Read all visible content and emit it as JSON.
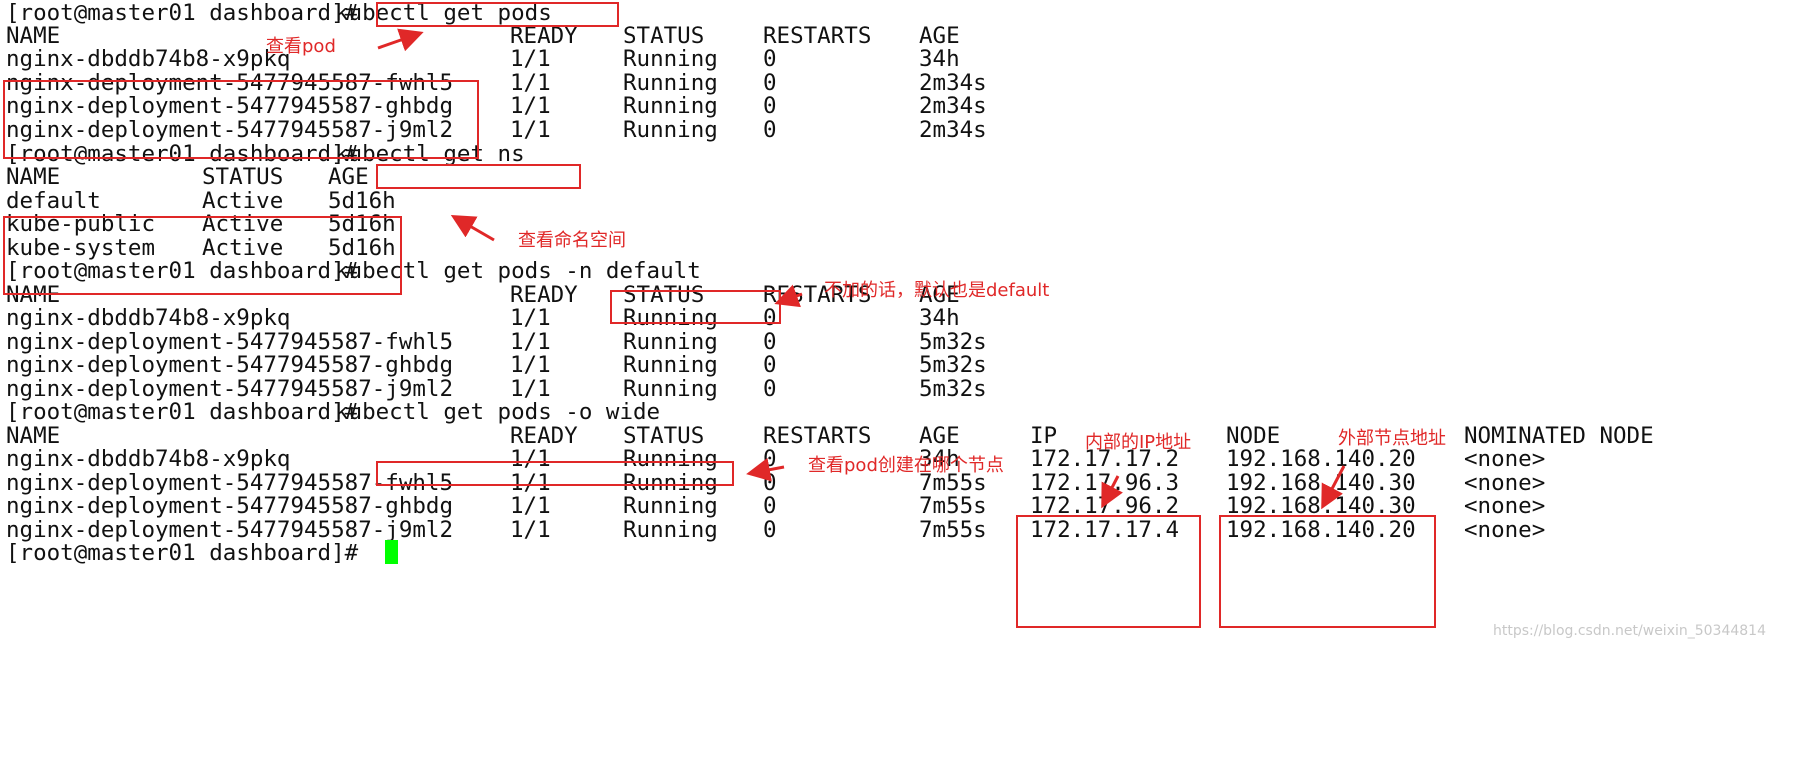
{
  "colors": {
    "annotation": "#e02828",
    "cursor": "#00ff00",
    "text": "#111111",
    "watermark": "#c8c8c8"
  },
  "terminal": {
    "blocks": [
      {
        "prompt": "[root@master01 dashboard]# ",
        "command": "kubectl get pods",
        "cols": [
          "NAME",
          "READY",
          "STATUS",
          "RESTARTS",
          "AGE"
        ],
        "rows": [
          [
            "nginx-dbddb74b8-x9pkq",
            "1/1",
            "Running",
            "0",
            "34h"
          ],
          [
            "nginx-deployment-5477945587-fwhl5",
            "1/1",
            "Running",
            "0",
            "2m34s"
          ],
          [
            "nginx-deployment-5477945587-ghbdg",
            "1/1",
            "Running",
            "0",
            "2m34s"
          ],
          [
            "nginx-deployment-5477945587-j9ml2",
            "1/1",
            "Running",
            "0",
            "2m34s"
          ]
        ]
      },
      {
        "prompt": "[root@master01 dashboard]# ",
        "command": "kubectl get ns",
        "cols": [
          "NAME",
          "STATUS",
          "AGE"
        ],
        "rows": [
          [
            "default",
            "Active",
            "5d16h"
          ],
          [
            "kube-public",
            "Active",
            "5d16h"
          ],
          [
            "kube-system",
            "Active",
            "5d16h"
          ]
        ]
      },
      {
        "prompt": "[root@master01 dashboard]# ",
        "command": "kubectl get pods -n default",
        "cols": [
          "NAME",
          "READY",
          "STATUS",
          "RESTARTS",
          "AGE"
        ],
        "rows": [
          [
            "nginx-dbddb74b8-x9pkq",
            "1/1",
            "Running",
            "0",
            "34h"
          ],
          [
            "nginx-deployment-5477945587-fwhl5",
            "1/1",
            "Running",
            "0",
            "5m32s"
          ],
          [
            "nginx-deployment-5477945587-ghbdg",
            "1/1",
            "Running",
            "0",
            "5m32s"
          ],
          [
            "nginx-deployment-5477945587-j9ml2",
            "1/1",
            "Running",
            "0",
            "5m32s"
          ]
        ]
      },
      {
        "prompt": "[root@master01 dashboard]# ",
        "command": "kubectl get pods -o wide",
        "cols": [
          "NAME",
          "READY",
          "STATUS",
          "RESTARTS",
          "AGE",
          "IP",
          "NODE",
          "NOMINATED NODE"
        ],
        "rows": [
          [
            "nginx-dbddb74b8-x9pkq",
            "1/1",
            "Running",
            "0",
            "34h",
            "172.17.17.2",
            "192.168.140.20",
            "<none>"
          ],
          [
            "nginx-deployment-5477945587-fwhl5",
            "1/1",
            "Running",
            "0",
            "7m55s",
            "172.17.96.3",
            "192.168.140.30",
            "<none>"
          ],
          [
            "nginx-deployment-5477945587-ghbdg",
            "1/1",
            "Running",
            "0",
            "7m55s",
            "172.17.96.2",
            "192.168.140.30",
            "<none>"
          ],
          [
            "nginx-deployment-5477945587-j9ml2",
            "1/1",
            "Running",
            "0",
            "7m55s",
            "172.17.17.4",
            "192.168.140.20",
            "<none>"
          ]
        ]
      }
    ],
    "final_prompt": "[root@master01 dashboard]# "
  },
  "annotations": {
    "view_pod": "查看pod",
    "view_namespace": "查看命名空间",
    "default_note": "不加的话，默认也是default",
    "pod_node_note": "查看pod创建在哪个节点",
    "internal_ip": "内部的IP地址",
    "external_node": "外部节点地址"
  },
  "watermark": "https://blog.csdn.net/weixin_50344814"
}
